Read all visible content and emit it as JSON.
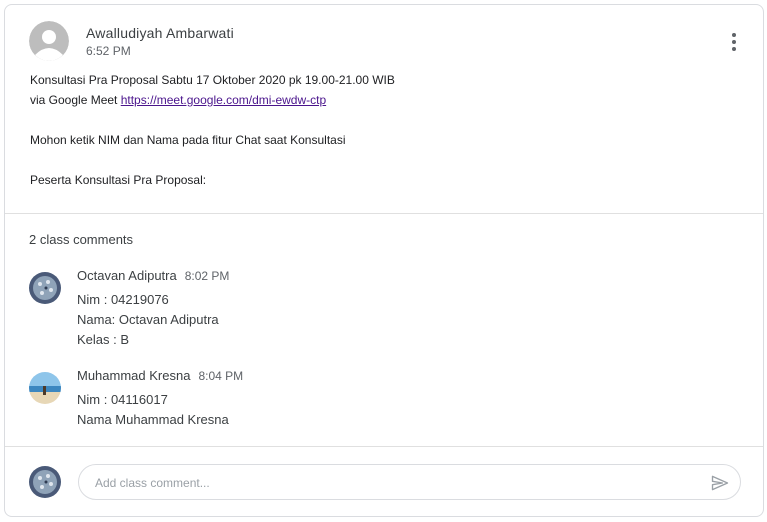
{
  "post": {
    "author": "Awalludiyah Ambarwati",
    "time": "6:52 PM",
    "line1": "Konsultasi Pra Proposal Sabtu 17 Oktober 2020 pk 19.00-21.00 WIB",
    "line2_prefix": "via Google Meet ",
    "link": "https://meet.google.com/dmi-ewdw-ctp",
    "line3": "Mohon ketik  NIM dan Nama pada fitur Chat saat Konsultasi",
    "line4": "Peserta Konsultasi Pra Proposal:"
  },
  "comments": {
    "count_label": "2 class comments",
    "items": [
      {
        "name": "Octavan Adiputra",
        "time": "8:02 PM",
        "lines": [
          "Nim : 04219076",
          "Nama: Octavan Adiputra",
          "Kelas : B"
        ]
      },
      {
        "name": "Muhammad Kresna",
        "time": "8:04 PM",
        "lines": [
          "Nim : 04116017",
          "Nama Muhammad Kresna"
        ]
      }
    ]
  },
  "composer": {
    "placeholder": "Add class comment..."
  },
  "icons": {
    "more": "more-vert-icon",
    "send": "send-icon"
  },
  "colors": {
    "link": "#4a148c",
    "border": "#dadce0",
    "secondary_text": "#5f6368"
  }
}
